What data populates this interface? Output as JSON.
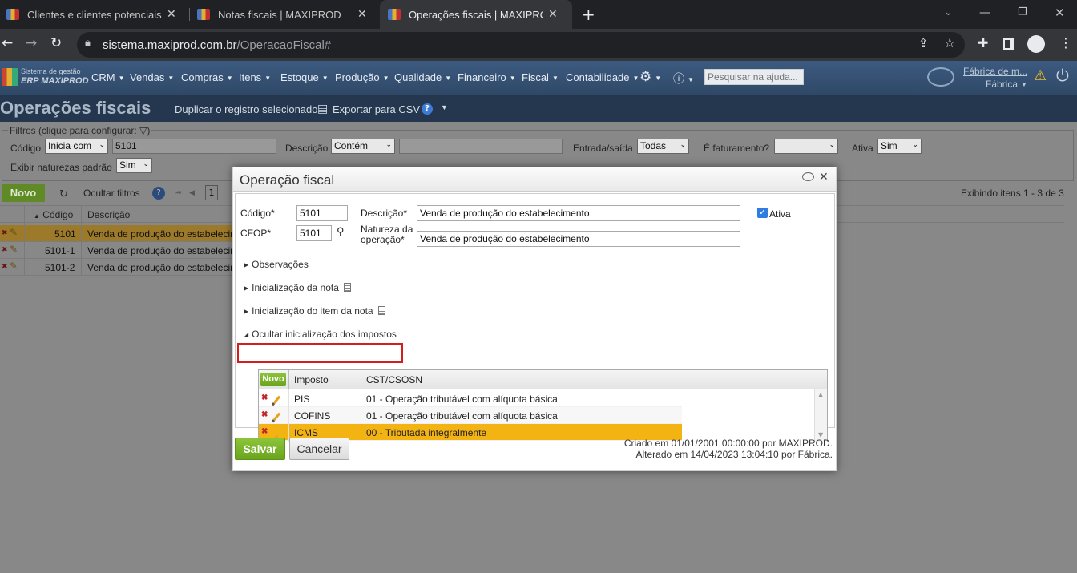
{
  "browser": {
    "tabs": [
      {
        "title": "Clientes e clientes potenciais | MAXIPROD",
        "close": "✕"
      },
      {
        "title": "Notas fiscais | MAXIPROD",
        "close": "✕"
      },
      {
        "title": "Operações fiscais | MAXIPROD",
        "close": "✕"
      }
    ],
    "new_tab": "+",
    "url_host": "sistema.maxiprod.com.br",
    "url_path": "/OperacaoFiscal#"
  },
  "app": {
    "logo_line1": "Sistema de gestão",
    "logo_line2": "ERP MAXIPROD",
    "menu": [
      "CRM",
      "Vendas",
      "Compras",
      "Itens",
      "Estoque",
      "Produção",
      "Qualidade",
      "Financeiro",
      "Fiscal",
      "Contabilidade"
    ],
    "help_placeholder": "Pesquisar na ajuda...",
    "company": "Fábrica de m...",
    "user": "Fábrica"
  },
  "page": {
    "title": "Operações fiscais",
    "actions": {
      "duplicate": "Duplicar o registro selecionado",
      "export": "Exportar para CSV"
    },
    "filters": {
      "legend": "Filtros (clique para configurar:",
      "codigo_label": "Código",
      "codigo_op": "Inicia com",
      "codigo_value": "5101",
      "descricao_label": "Descrição",
      "descricao_op": "Contém",
      "entrada_label": "Entrada/saída",
      "entrada_value": "Todas",
      "faturamento_label": "É faturamento?",
      "ativa_label": "Ativa",
      "ativa_value": "Sim",
      "naturezas_label": "Exibir naturezas padrão",
      "naturezas_value": "Sim"
    },
    "list_toolbar": {
      "new": "Novo",
      "hide_filters": "Ocultar filtros",
      "page": "1",
      "count": "Exibindo itens 1 - 3 de 3"
    },
    "list": {
      "headers": [
        "Código",
        "Descrição"
      ],
      "rows": [
        {
          "code": "5101",
          "desc": "Venda de produção do estabelecimento"
        },
        {
          "code": "5101-1",
          "desc": "Venda de produção do estabelecimento"
        },
        {
          "code": "5101-2",
          "desc": "Venda de produção do estabelecimento"
        }
      ]
    }
  },
  "modal": {
    "title": "Operação fiscal",
    "codigo_label": "Código*",
    "codigo_value": "5101",
    "cfop_label": "CFOP*",
    "cfop_value": "5101",
    "descricao_label": "Descrição*",
    "descricao_value": "Venda de produção do estabelecimento",
    "natureza_label": "Natureza da operação*",
    "natureza_value": "Venda de produção do estabelecimento",
    "ativa_label": "Ativa",
    "sections": [
      "Observações",
      "Inicialização da nota",
      "Inicialização do item da nota",
      "Ocultar inicialização dos impostos"
    ],
    "grid": {
      "new": "Novo",
      "headers": [
        "Imposto",
        "CST/CSOSN"
      ],
      "rows": [
        {
          "imposto": "PIS",
          "cst": "01 - Operação tributável com alíquota básica"
        },
        {
          "imposto": "COFINS",
          "cst": "01 - Operação tributável com alíquota básica"
        },
        {
          "imposto": "ICMS",
          "cst": "00 - Tributada integralmente"
        }
      ]
    },
    "save": "Salvar",
    "cancel": "Cancelar",
    "created": "Criado em 01/01/2001 00:00:00 por MAXIPROD.",
    "updated": "Alterado em 14/04/2023 13:04:10 por Fábrica."
  },
  "colors": {
    "accent_green": "#7ab52a",
    "selected_row": "#f3b313",
    "nav_bg": "#334d6e",
    "highlight_box": "#d41e1e"
  }
}
